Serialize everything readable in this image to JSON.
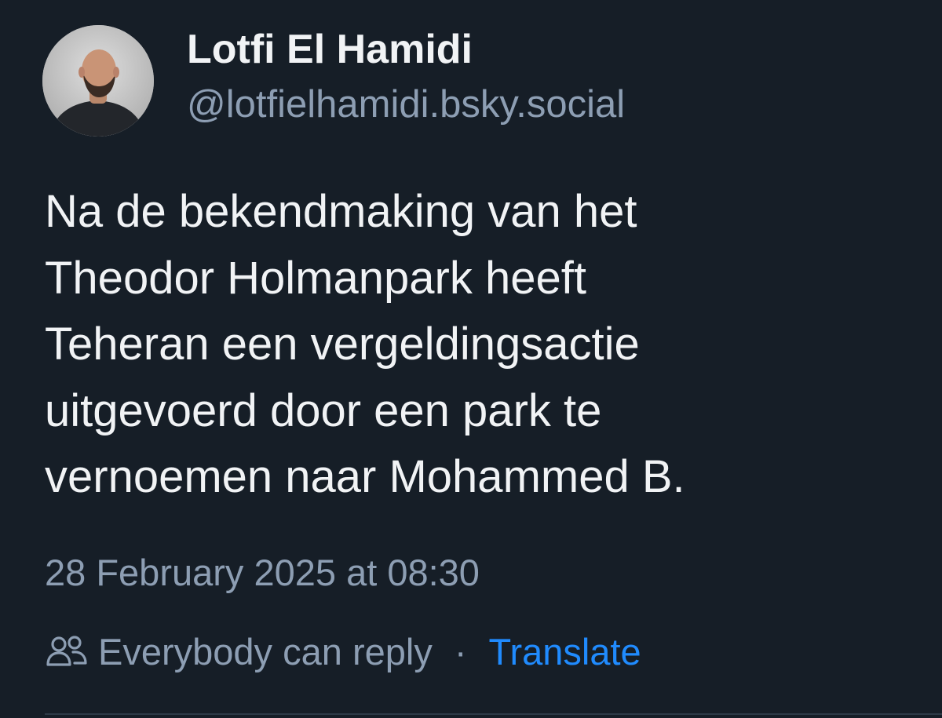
{
  "author": {
    "display_name": "Lotfi El Hamidi",
    "handle": "@lotfielhamidi.bsky.social",
    "avatar_icon": "avatar-photo"
  },
  "post": {
    "text_lines": [
      "Na de bekendmaking van het",
      "Theodor Holmanpark heeft",
      "Teheran een vergeldingsactie",
      "uitgevoerd door een park te",
      "vernoemen naar Mohammed B."
    ],
    "timestamp": "28 February 2025 at 08:30"
  },
  "meta": {
    "reply_icon": "people-icon",
    "reply_setting": "Everybody can reply",
    "separator": "·",
    "translate_label": "Translate"
  },
  "colors": {
    "background": "#161e27",
    "text": "#f1f3f5",
    "muted": "#8d9eb3",
    "link": "#208bfe"
  }
}
